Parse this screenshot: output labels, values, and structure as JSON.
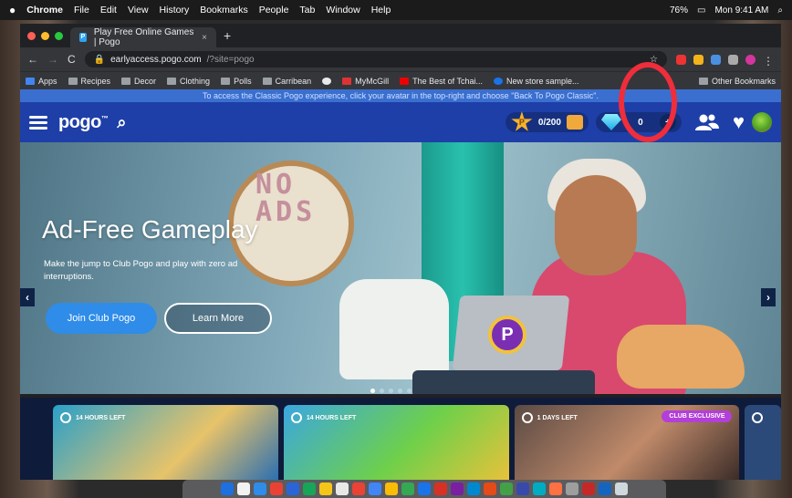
{
  "menubar": {
    "apple": "",
    "app": "Chrome",
    "items": [
      "File",
      "Edit",
      "View",
      "History",
      "Bookmarks",
      "People",
      "Tab",
      "Window",
      "Help"
    ],
    "battery": "76%",
    "clock": "Mon 9:41 AM"
  },
  "browser": {
    "tab_title": "Play Free Online Games | Pogo",
    "tab_favicon": "P",
    "url_host": "earlyaccess.pogo.com",
    "url_path": "/?site=pogo",
    "bookmarks": [
      "Apps",
      "Recipes",
      "Decor",
      "Clothing",
      "Polls",
      "Carribean",
      "",
      "MyMcGill",
      "The Best of Tchai...",
      "New store sample..."
    ],
    "other_bookmarks": "Other Bookmarks"
  },
  "page": {
    "notice": "To access the Classic Pogo experience, click your avatar in the top-right and choose \"Back To Pogo Classic\".",
    "logo": "pogo",
    "logo_mark": "™",
    "stars_count": "0/200",
    "star_letter": "P",
    "gems_count": "0",
    "hero": {
      "title": "Ad-Free Gameplay",
      "subtitle": "Make the jump to Club Pogo and play with zero ad interruptions.",
      "join_label": "Join Club Pogo",
      "learn_label": "Learn More",
      "hoop_text": "NO ADS",
      "laptop_logo": "P"
    },
    "cards": [
      {
        "timer": "14 HOURS LEFT",
        "badge": ""
      },
      {
        "timer": "14 HOURS LEFT",
        "badge": ""
      },
      {
        "timer": "1 DAYS LEFT",
        "badge": "CLUB EXCLUSIVE"
      },
      {
        "timer": "",
        "badge": ""
      }
    ]
  },
  "colors": {
    "nav_blue": "#1e3fa8",
    "notice_blue": "#3a6fd0",
    "join_button": "#2f8ce8",
    "highlight_ring": "#ef2d3b",
    "club_exclusive": "#b33fd9"
  },
  "icons": [
    "apple-icon",
    "hamburger-icon",
    "search-icon",
    "star-icon",
    "treasure-chest-icon",
    "gem-icon",
    "plus-icon",
    "friends-icon",
    "heart-icon",
    "avatar-icon",
    "chevron-left-icon",
    "chevron-right-icon",
    "clock-icon"
  ]
}
